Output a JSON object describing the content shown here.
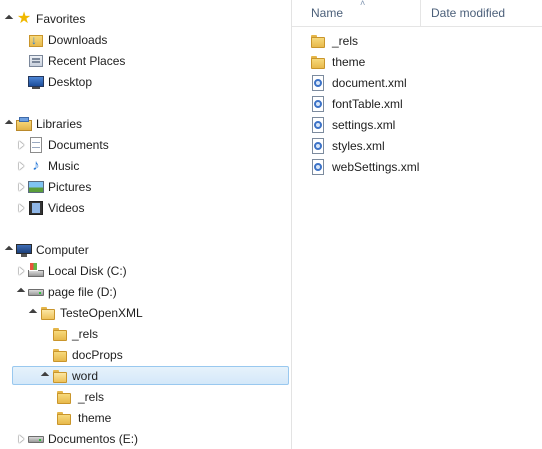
{
  "nav": {
    "favorites": {
      "label": "Favorites",
      "items": [
        {
          "label": "Downloads"
        },
        {
          "label": "Recent Places"
        },
        {
          "label": "Desktop"
        }
      ]
    },
    "libraries": {
      "label": "Libraries",
      "items": [
        {
          "label": "Documents"
        },
        {
          "label": "Music"
        },
        {
          "label": "Pictures"
        },
        {
          "label": "Videos"
        }
      ]
    },
    "computer": {
      "label": "Computer",
      "drives": [
        {
          "label": "Local Disk (C:)"
        },
        {
          "label": "page file (D:)"
        },
        {
          "label": "Documentos (E:)"
        }
      ],
      "tree": {
        "project": "TesteOpenXML",
        "project_children": [
          "_rels",
          "docProps",
          "word"
        ],
        "word_children": [
          "_rels",
          "theme"
        ]
      }
    }
  },
  "content": {
    "columns": {
      "name": "Name",
      "date": "Date modified"
    },
    "files": [
      {
        "label": "_rels",
        "type": "folder"
      },
      {
        "label": "theme",
        "type": "folder"
      },
      {
        "label": "document.xml",
        "type": "xml"
      },
      {
        "label": "fontTable.xml",
        "type": "xml"
      },
      {
        "label": "settings.xml",
        "type": "xml"
      },
      {
        "label": "styles.xml",
        "type": "xml"
      },
      {
        "label": "webSettings.xml",
        "type": "xml"
      }
    ]
  }
}
